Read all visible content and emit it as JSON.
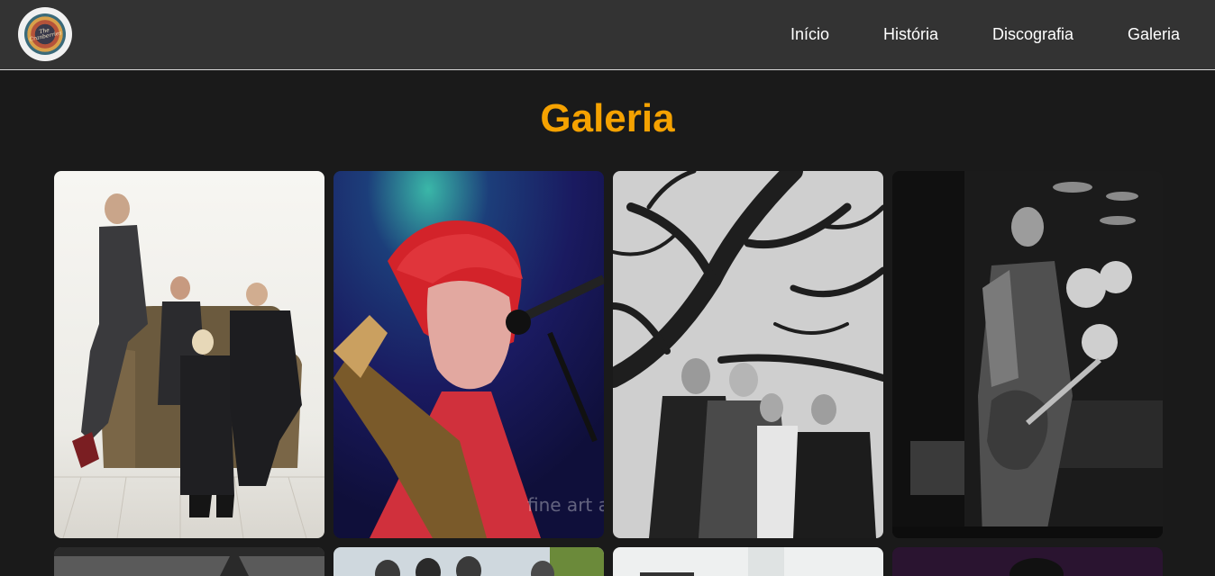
{
  "header": {
    "logo_text": "The Cranberries",
    "nav": [
      {
        "label": "Início"
      },
      {
        "label": "História"
      },
      {
        "label": "Discografia"
      },
      {
        "label": "Galeria"
      }
    ]
  },
  "main": {
    "title": "Galeria"
  },
  "gallery": {
    "photo1_watermark": "fine art america",
    "items": [
      {
        "kind": "band-photo-sofa"
      },
      {
        "kind": "singer-microphone"
      },
      {
        "kind": "band-photo-tree"
      },
      {
        "kind": "guitarist-drums"
      },
      {
        "kind": "photo"
      },
      {
        "kind": "photo"
      },
      {
        "kind": "photo"
      },
      {
        "kind": "photo"
      }
    ]
  },
  "colors": {
    "header_bg": "#333333",
    "page_bg": "#1a1a1a",
    "title_accent": "#f5a201",
    "nav_text": "#ffffff"
  }
}
